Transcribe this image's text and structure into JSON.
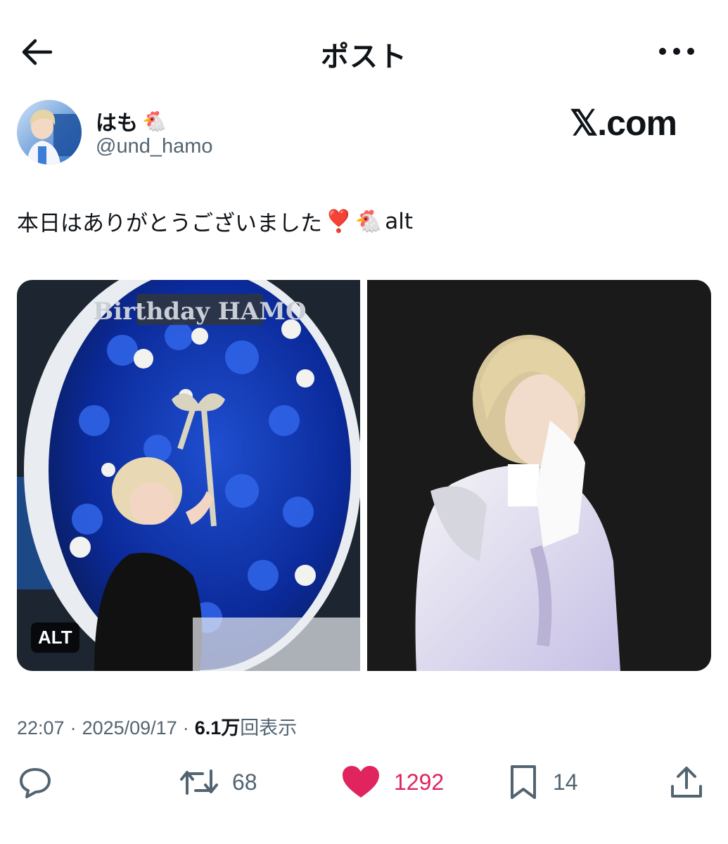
{
  "header": {
    "title": "ポスト",
    "back_icon": "arrow-left-icon",
    "more_icon": "ellipsis-icon"
  },
  "author": {
    "display_name": "はも",
    "display_emoji": "🐔",
    "handle": "@und_hamo",
    "watermark": "𝕏.com"
  },
  "post": {
    "text": "本日はありがとうございました",
    "emoji_heart": "❣️",
    "emoji_chicken": "🐔",
    "text_tail": "alt"
  },
  "media": {
    "alt_badge": "ALT",
    "image_left_caption": "Birthday HAMO"
  },
  "meta": {
    "time": "22:07",
    "sep1": "·",
    "date": "2025/09/17",
    "sep2": "·",
    "views_value": "6.1万",
    "views_label": "回表示"
  },
  "actions": {
    "reply_count": "",
    "repost_count": "68",
    "like_count": "1292",
    "bookmark_count": "14"
  },
  "colors": {
    "text": "#0f1419",
    "secondary": "#536471",
    "like": "#e0245e"
  }
}
